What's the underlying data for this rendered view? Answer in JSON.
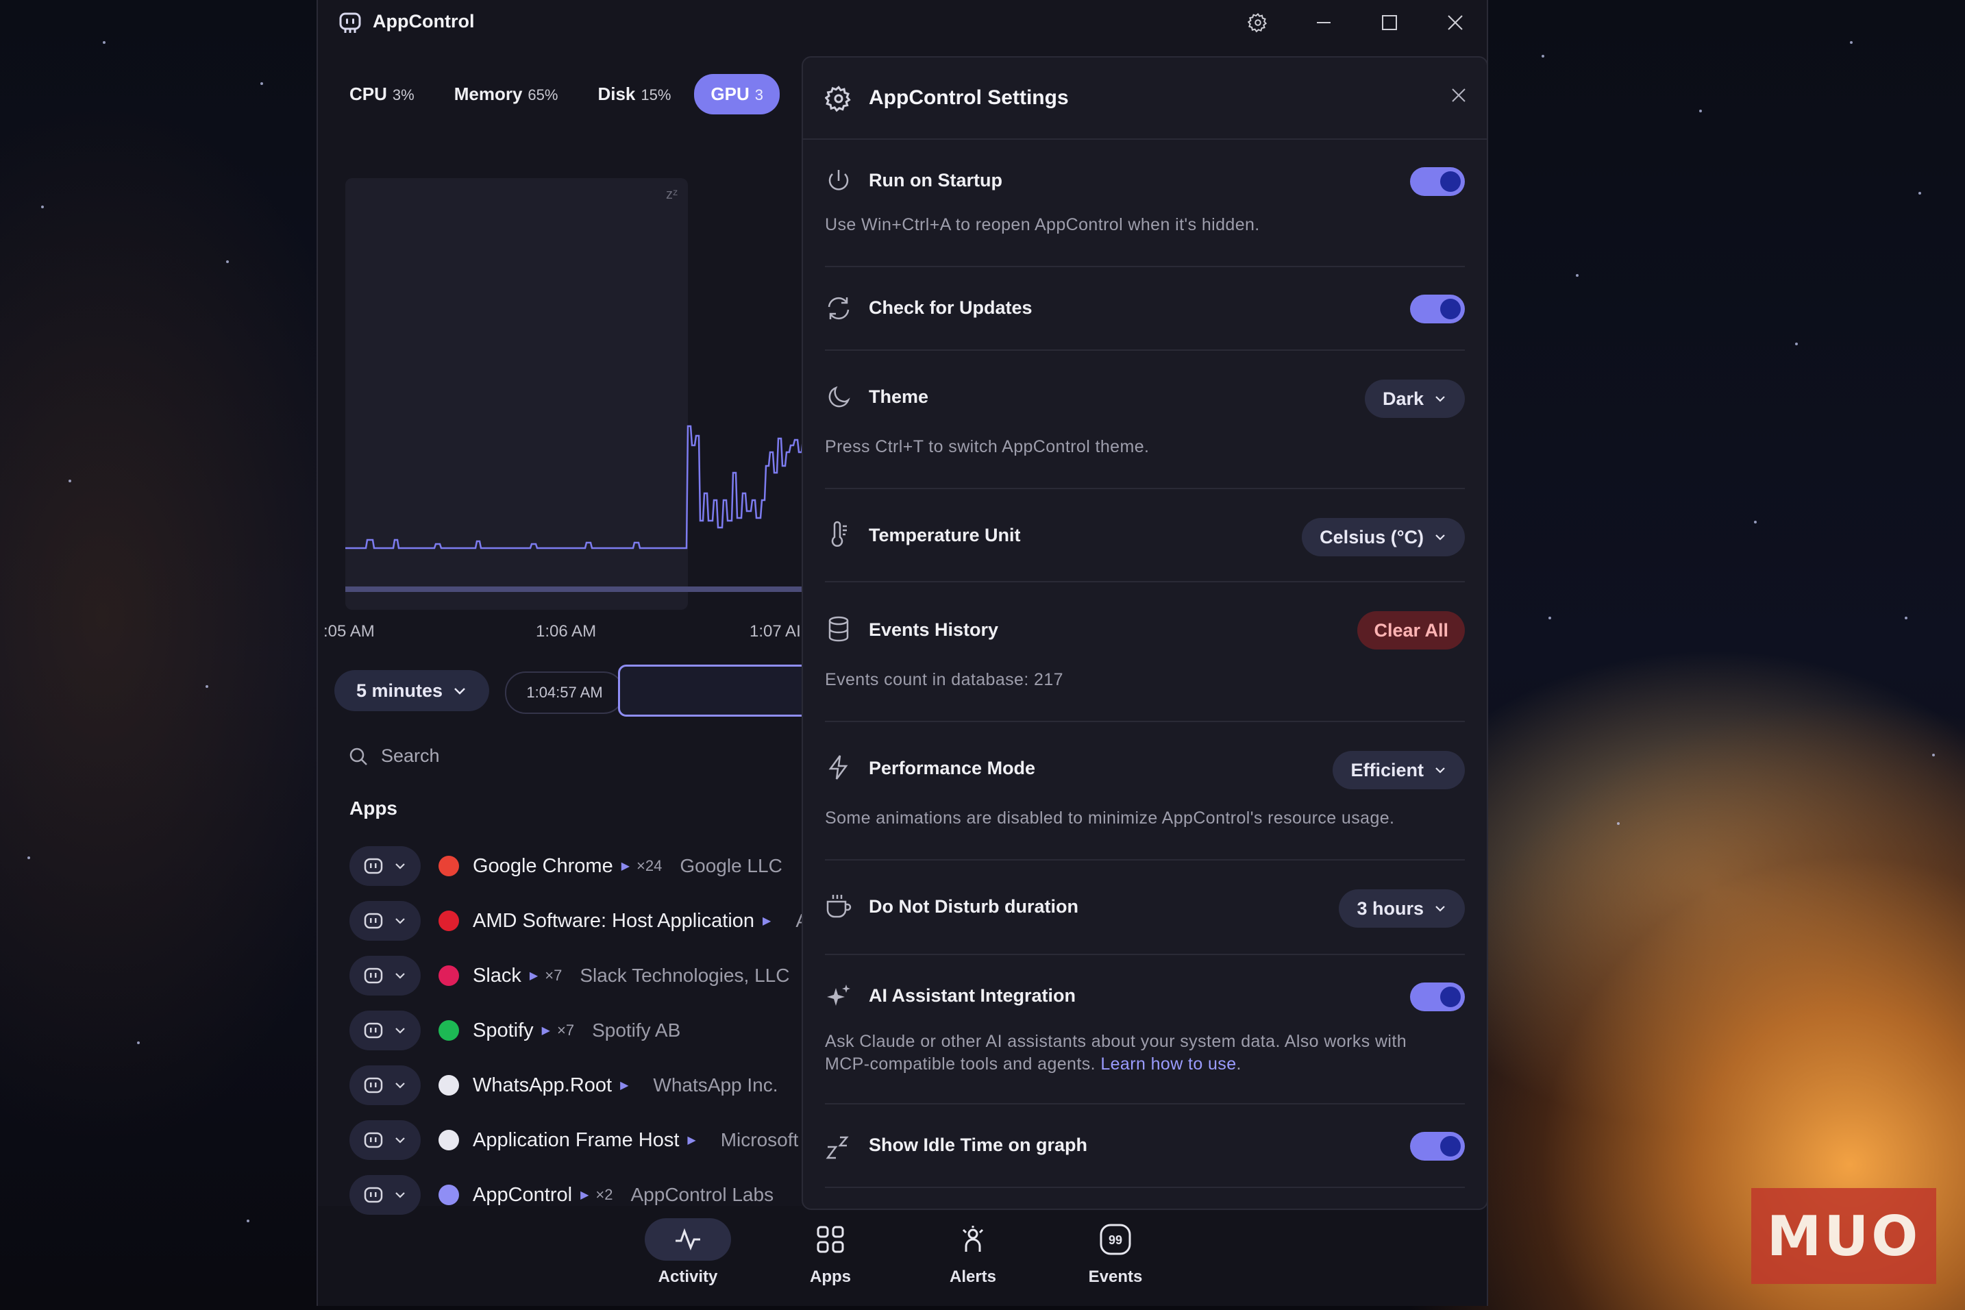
{
  "window": {
    "title": "AppControl"
  },
  "metrics": [
    {
      "label": "CPU",
      "value": "3%"
    },
    {
      "label": "Memory",
      "value": "65%"
    },
    {
      "label": "Disk",
      "value": "15%"
    },
    {
      "label": "GPU",
      "value": "3"
    }
  ],
  "chart": {
    "idle_icon": "zᶻ",
    "time_labels": [
      ":05 AM",
      "1:06 AM",
      "1:07 AI"
    ]
  },
  "range": {
    "label": "5 minutes",
    "time": "1:04:57 AM"
  },
  "search": {
    "placeholder": "Search"
  },
  "apps": {
    "header": "Apps",
    "rows": [
      {
        "name": "Google Chrome",
        "count": "×24",
        "publisher": "Google LLC",
        "icon": "chrome-icon",
        "color": "#e94235"
      },
      {
        "name": "AMD Software: Host Application",
        "count": "",
        "publisher": "A",
        "icon": "amd-icon",
        "color": "#e01f2e"
      },
      {
        "name": "Slack",
        "count": "×7",
        "publisher": "Slack Technologies, LLC",
        "icon": "slack-icon",
        "color": "#e01e5a"
      },
      {
        "name": "Spotify",
        "count": "×7",
        "publisher": "Spotify AB",
        "icon": "spotify-icon",
        "color": "#1db954"
      },
      {
        "name": "WhatsApp.Root",
        "count": "",
        "publisher": "WhatsApp Inc.",
        "icon": "window-icon",
        "color": "#e8e8f0"
      },
      {
        "name": "Application Frame Host",
        "count": "",
        "publisher": "Microsoft",
        "icon": "window-icon",
        "color": "#e8e8f0"
      },
      {
        "name": "AppControl",
        "count": "×2",
        "publisher": "AppControl Labs",
        "icon": "appcontrol-icon",
        "color": "#8f8ef5"
      }
    ]
  },
  "nav": [
    {
      "label": "Activity",
      "icon": "activity-icon"
    },
    {
      "label": "Apps",
      "icon": "grid-icon"
    },
    {
      "label": "Alerts",
      "icon": "alerts-icon"
    },
    {
      "label": "Events",
      "icon": "events-icon"
    }
  ],
  "settings": {
    "title": "AppControl Settings",
    "run_on_startup": {
      "label": "Run on Startup",
      "desc": "Use Win+Ctrl+A to reopen AppControl when it's hidden.",
      "on": true
    },
    "check_updates": {
      "label": "Check for Updates",
      "on": true
    },
    "theme": {
      "label": "Theme",
      "value": "Dark",
      "desc": "Press Ctrl+T to switch AppControl theme."
    },
    "temperature": {
      "label": "Temperature Unit",
      "value": "Celsius (°C)"
    },
    "events_history": {
      "label": "Events History",
      "button": "Clear All",
      "desc": "Events count in database: 217"
    },
    "performance": {
      "label": "Performance Mode",
      "value": "Efficient",
      "desc": "Some animations are disabled to minimize AppControl's resource usage."
    },
    "dnd": {
      "label": "Do Not Disturb duration",
      "value": "3 hours"
    },
    "ai": {
      "label": "AI Assistant Integration",
      "desc_line1": "Ask Claude or other AI assistants about your system data. Also works with",
      "desc_line2": "MCP-compatible tools and agents.",
      "link": "Learn how to use",
      "on": true
    },
    "idle": {
      "label": "Show Idle Time on graph",
      "on": true
    }
  },
  "watermark": "MUO",
  "colors": {
    "accent": "#7d7cf0",
    "toggle_knob": "#1f2a9e",
    "danger": "#5a1e24"
  }
}
